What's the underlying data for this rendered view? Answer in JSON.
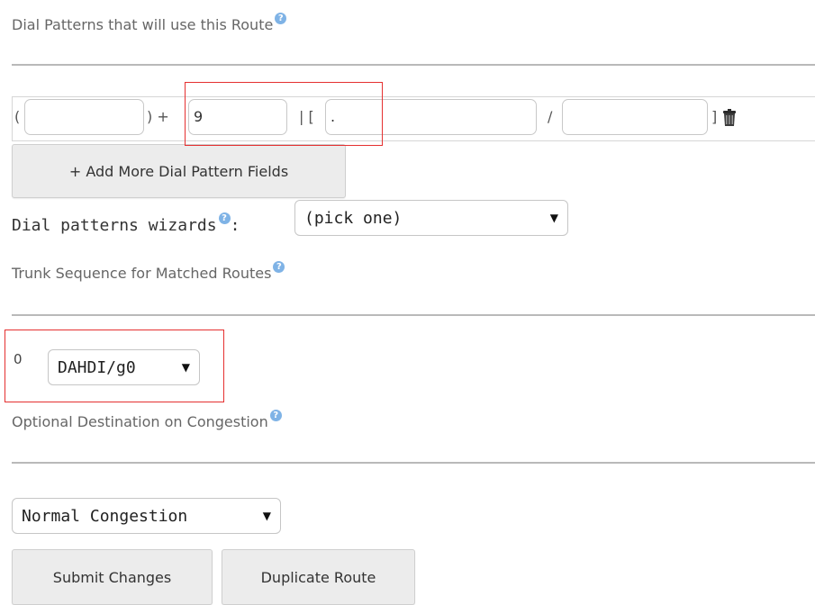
{
  "dial_patterns": {
    "title": "Dial Patterns that will use this Route",
    "row": {
      "open_paren": "(",
      "close_paren_plus": ") +",
      "prepend_value": "",
      "prefix_value": "9",
      "pipe_bracket": "| [",
      "match_value": ".",
      "slash": "/",
      "callerid_value": "",
      "close_bracket": "]"
    },
    "add_more_label": "+ Add More Dial Pattern Fields",
    "wizards_label": "Dial patterns wizards",
    "wizards_colon": ":",
    "wizards_selected": "(pick one)"
  },
  "trunk_sequence": {
    "title": "Trunk Sequence for Matched Routes",
    "index": "0",
    "trunk_selected": "DAHDI/g0"
  },
  "congestion": {
    "title": "Optional Destination on Congestion",
    "selected": "Normal Congestion"
  },
  "actions": {
    "submit_label": "Submit Changes",
    "duplicate_label": "Duplicate Route"
  },
  "icons": {
    "help": "help-icon",
    "trash": "trash-icon",
    "caret": "chevron-down-icon"
  },
  "colors": {
    "annotation_red": "#e53030",
    "help_blue": "#7fb3e6"
  }
}
